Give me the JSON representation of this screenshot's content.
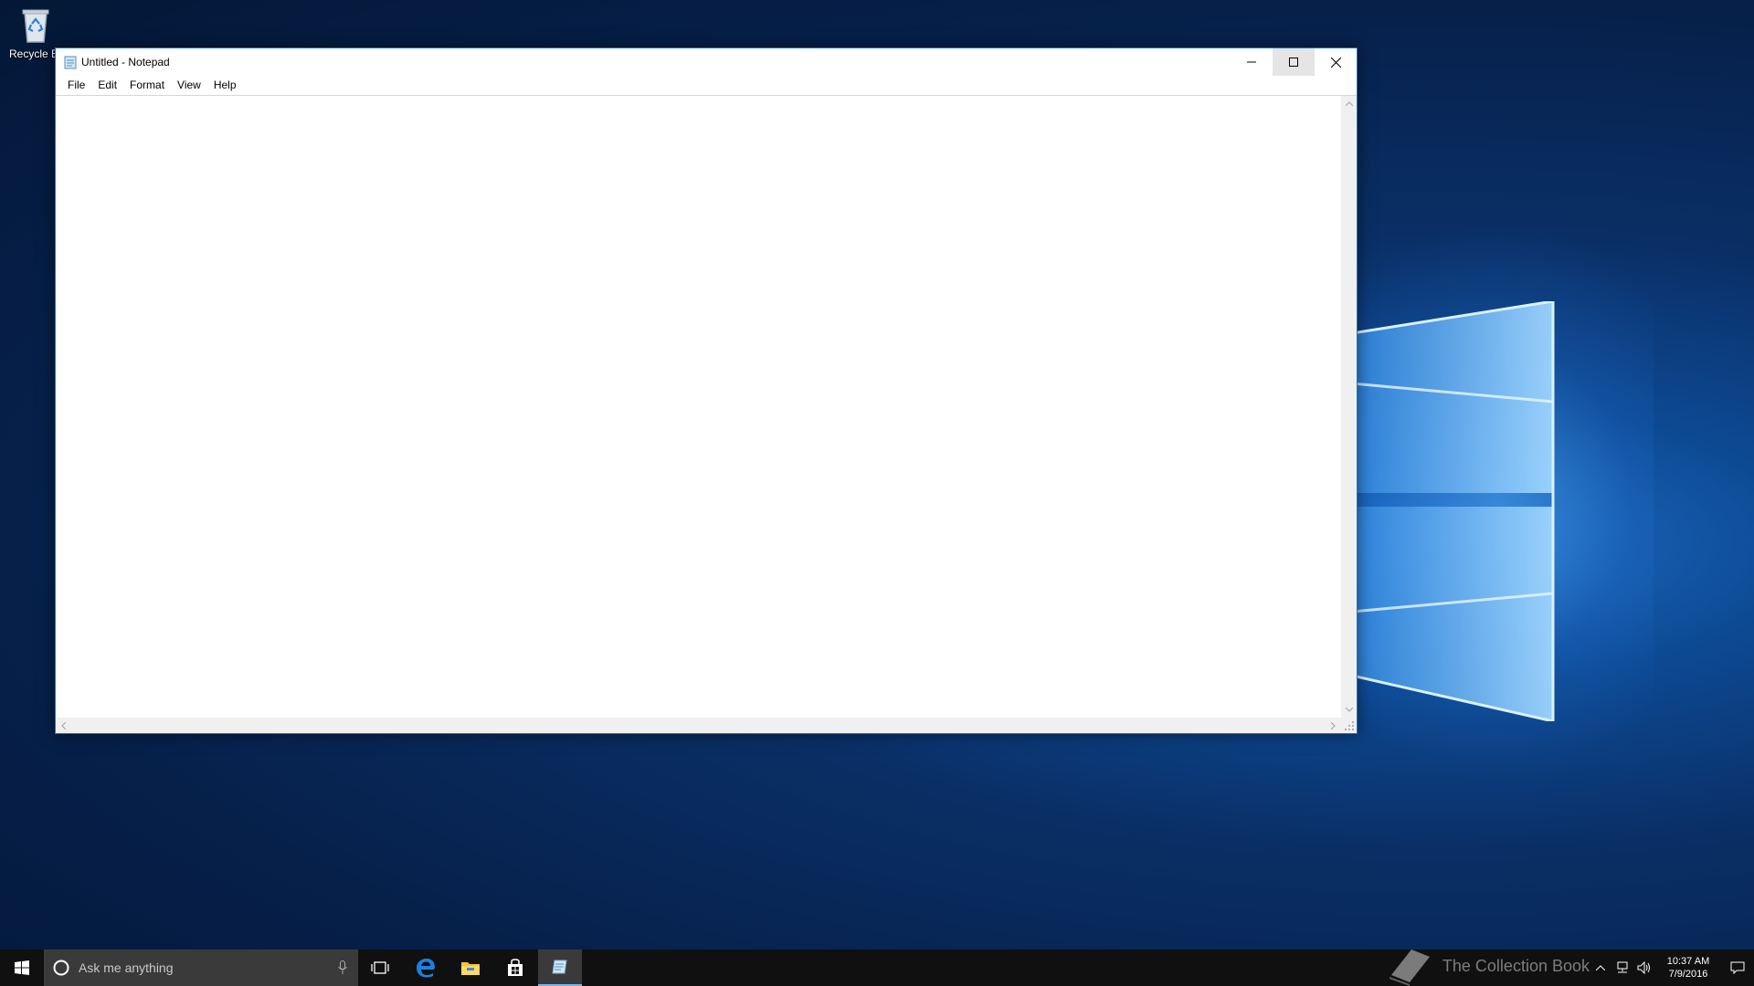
{
  "desktop": {
    "icons": [
      {
        "label": "Recycle Bin",
        "icon": "recycle-bin-icon"
      }
    ]
  },
  "window": {
    "title": "Untitled - Notepad",
    "app_icon": "notepad-icon",
    "controls": {
      "minimize": "minimize-icon",
      "maximize": "maximize-icon",
      "close": "close-icon"
    },
    "menu": [
      "File",
      "Edit",
      "Format",
      "View",
      "Help"
    ],
    "content": ""
  },
  "taskbar": {
    "search_placeholder": "Ask me anything",
    "pinned": [
      "task-view-icon",
      "edge-icon",
      "file-explorer-icon",
      "store-icon",
      "notepad-icon"
    ],
    "active_app": "notepad-icon",
    "tray_icons": [
      "chevron-up-icon",
      "network-icon",
      "volume-icon",
      "action-center-icon"
    ],
    "clock": {
      "time": "10:37 AM",
      "date": "7/9/2016"
    },
    "watermark": "The Collection Book"
  },
  "colors": {
    "accent": "#1a73c9",
    "taskbar": "#101010",
    "search_box": "#3a3a3a",
    "active_indicator": "#76b9ed"
  }
}
